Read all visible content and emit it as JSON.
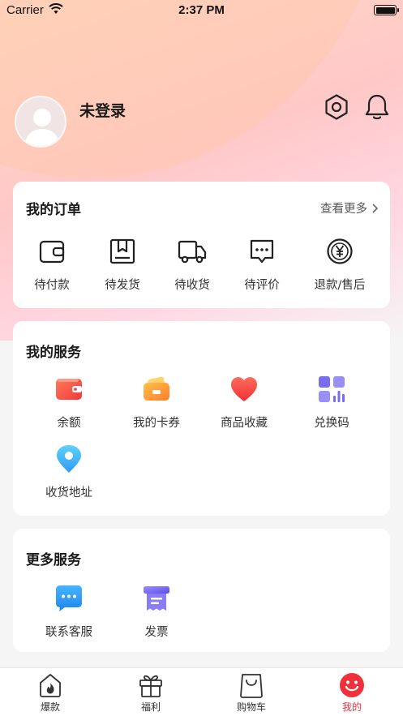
{
  "status_bar": {
    "carrier": "Carrier",
    "time": "2:37 PM"
  },
  "profile": {
    "username": "未登录"
  },
  "orders": {
    "title": "我的订单",
    "more_label": "查看更多",
    "items": [
      {
        "label": "待付款",
        "icon": "wallet-icon"
      },
      {
        "label": "待发货",
        "icon": "package-icon"
      },
      {
        "label": "待收货",
        "icon": "truck-icon"
      },
      {
        "label": "待评价",
        "icon": "chat-icon"
      },
      {
        "label": "退款/售后",
        "icon": "yen-icon"
      }
    ]
  },
  "services": {
    "title": "我的服务",
    "items": [
      {
        "label": "余额",
        "icon": "balance-wallet-icon"
      },
      {
        "label": "我的卡券",
        "icon": "coupon-icon"
      },
      {
        "label": "商品收藏",
        "icon": "heart-icon"
      },
      {
        "label": "兑换码",
        "icon": "redeem-code-icon"
      },
      {
        "label": "收货地址",
        "icon": "location-pin-icon"
      }
    ]
  },
  "more_services": {
    "title": "更多服务",
    "items": [
      {
        "label": "联系客服",
        "icon": "customer-service-icon"
      },
      {
        "label": "发票",
        "icon": "invoice-icon"
      }
    ]
  },
  "tab_bar": {
    "active_index": 3,
    "items": [
      {
        "label": "爆款",
        "icon": "hot-house-icon"
      },
      {
        "label": "福利",
        "icon": "gift-icon"
      },
      {
        "label": "购物车",
        "icon": "shopping-bag-icon"
      },
      {
        "label": "我的",
        "icon": "smiley-icon"
      }
    ]
  },
  "colors": {
    "accent": "#f0303a",
    "card": "#ffffff",
    "background": "#f5f5f5"
  }
}
